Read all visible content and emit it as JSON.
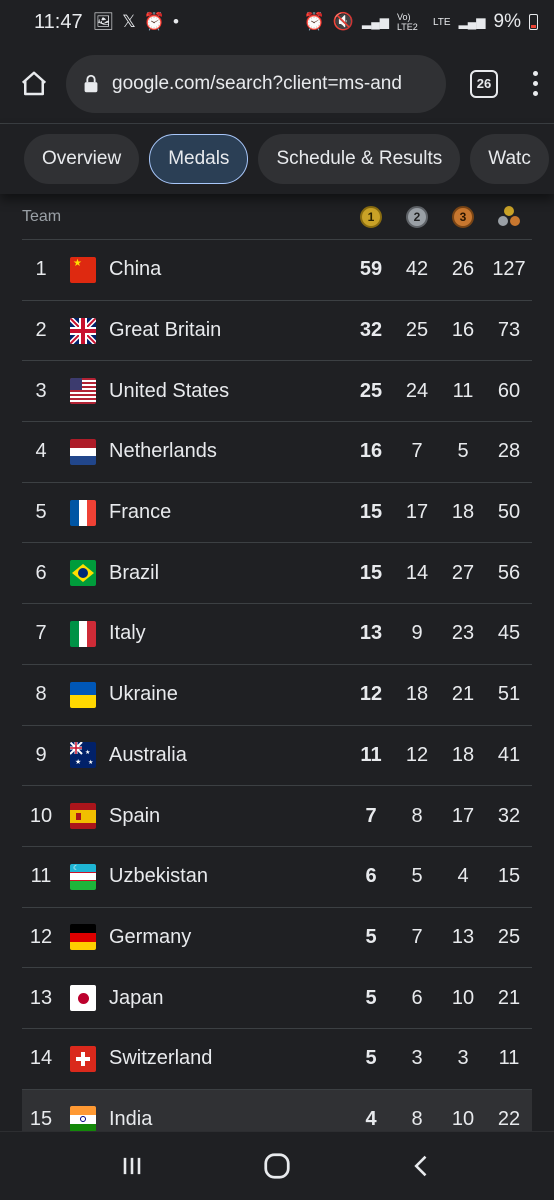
{
  "status": {
    "time": "11:47",
    "battery": "9%",
    "network": "LTE",
    "carrier": "Vo) LTE2"
  },
  "browser": {
    "url": "google.com/search?client=ms-and",
    "tab_count": "26"
  },
  "chips": [
    {
      "label": "Overview"
    },
    {
      "label": "Medals"
    },
    {
      "label": "Schedule & Results"
    },
    {
      "label": "Watc"
    }
  ],
  "table": {
    "header": {
      "team": "Team",
      "gold": "1",
      "silver": "2",
      "bronze": "3"
    },
    "rows": [
      {
        "rank": "1",
        "country": "China",
        "gold": "59",
        "silver": "42",
        "bronze": "26",
        "total": "127"
      },
      {
        "rank": "2",
        "country": "Great Britain",
        "gold": "32",
        "silver": "25",
        "bronze": "16",
        "total": "73"
      },
      {
        "rank": "3",
        "country": "United States",
        "gold": "25",
        "silver": "24",
        "bronze": "11",
        "total": "60"
      },
      {
        "rank": "4",
        "country": "Netherlands",
        "gold": "16",
        "silver": "7",
        "bronze": "5",
        "total": "28"
      },
      {
        "rank": "5",
        "country": "France",
        "gold": "15",
        "silver": "17",
        "bronze": "18",
        "total": "50"
      },
      {
        "rank": "6",
        "country": "Brazil",
        "gold": "15",
        "silver": "14",
        "bronze": "27",
        "total": "56"
      },
      {
        "rank": "7",
        "country": "Italy",
        "gold": "13",
        "silver": "9",
        "bronze": "23",
        "total": "45"
      },
      {
        "rank": "8",
        "country": "Ukraine",
        "gold": "12",
        "silver": "18",
        "bronze": "21",
        "total": "51"
      },
      {
        "rank": "9",
        "country": "Australia",
        "gold": "11",
        "silver": "12",
        "bronze": "18",
        "total": "41"
      },
      {
        "rank": "10",
        "country": "Spain",
        "gold": "7",
        "silver": "8",
        "bronze": "17",
        "total": "32"
      },
      {
        "rank": "11",
        "country": "Uzbekistan",
        "gold": "6",
        "silver": "5",
        "bronze": "4",
        "total": "15"
      },
      {
        "rank": "12",
        "country": "Germany",
        "gold": "5",
        "silver": "7",
        "bronze": "13",
        "total": "25"
      },
      {
        "rank": "13",
        "country": "Japan",
        "gold": "5",
        "silver": "6",
        "bronze": "10",
        "total": "21"
      },
      {
        "rank": "14",
        "country": "Switzerland",
        "gold": "5",
        "silver": "3",
        "bronze": "3",
        "total": "11"
      },
      {
        "rank": "15",
        "country": "India",
        "gold": "4",
        "silver": "8",
        "bronze": "10",
        "total": "22"
      }
    ]
  }
}
